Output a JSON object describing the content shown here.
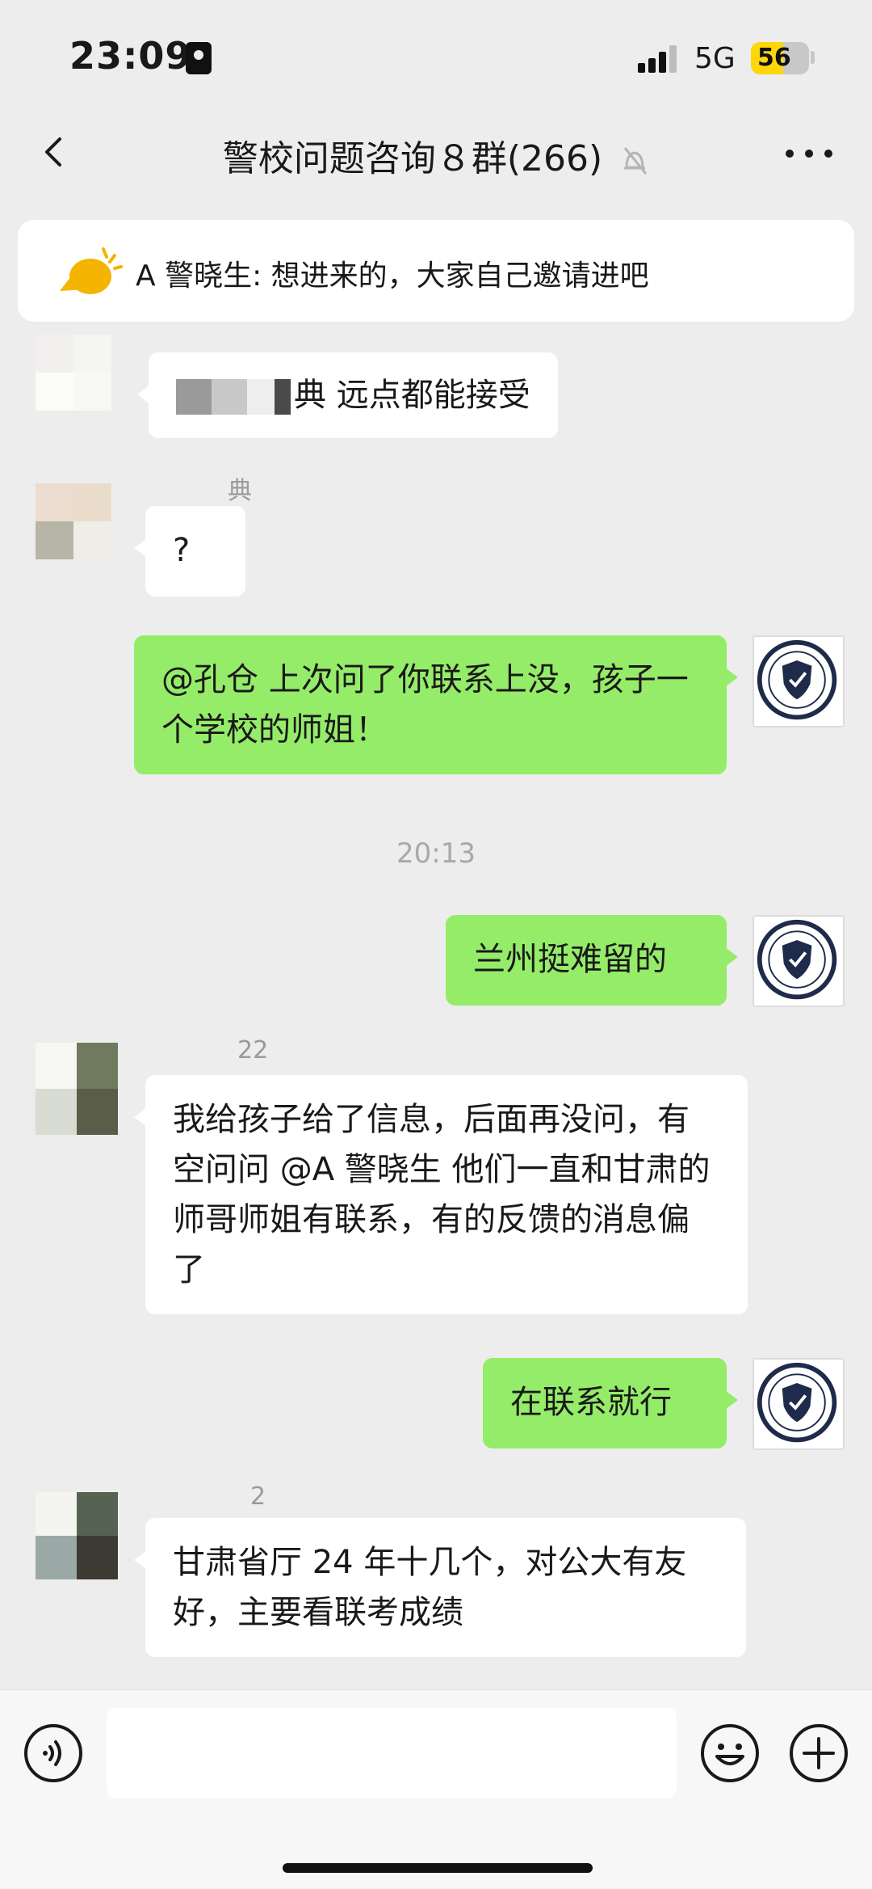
{
  "status_bar": {
    "time": "23:09",
    "network": "5G",
    "battery": "56"
  },
  "header": {
    "title": "警校问题咨询８群(266)"
  },
  "notice": {
    "text": "A 警晓生: 想进来的，大家自己邀请进吧"
  },
  "messages": {
    "m1": {
      "text": "典 远点都能接受"
    },
    "m2": {
      "sender": "典",
      "text": "?"
    },
    "m3": {
      "text": "@孔仓 上次问了你联系上没，孩子一个学校的师姐！"
    },
    "divider": {
      "time": "20:13"
    },
    "m4": {
      "text": "兰州挺难留的"
    },
    "m5": {
      "sender": "22",
      "text": "我给孩子给了信息，后面再没问，有空问问 @A 警晓生 他们一直和甘肃的师哥师姐有联系，有的反馈的消息偏了"
    },
    "m6": {
      "text": "在联系就行"
    },
    "m7": {
      "sender": "2",
      "text": "甘肃省厅 24 年十几个，对公大有友好，主要看联考成绩"
    }
  },
  "input": {
    "placeholder": ""
  }
}
